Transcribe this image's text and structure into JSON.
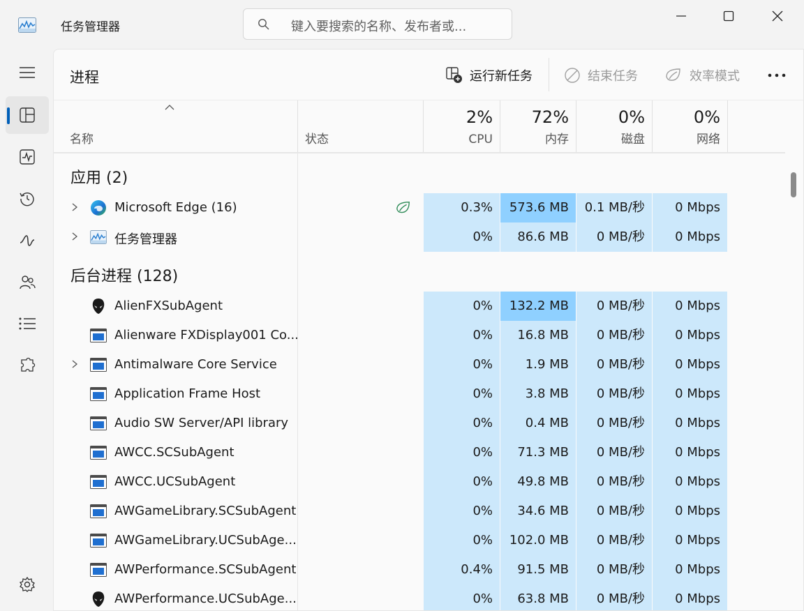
{
  "window": {
    "title": "任务管理器",
    "search_placeholder": "键入要搜索的名称、发布者或...",
    "controls": {
      "minimize": "minimize-icon",
      "maximize": "maximize-icon",
      "close": "close-icon"
    }
  },
  "nav": {
    "items": [
      {
        "id": "menu",
        "icon": "hamburger-icon"
      },
      {
        "id": "processes",
        "icon": "processes-icon",
        "selected": true
      },
      {
        "id": "performance",
        "icon": "performance-icon"
      },
      {
        "id": "app-history",
        "icon": "history-icon"
      },
      {
        "id": "startup",
        "icon": "startup-icon"
      },
      {
        "id": "users",
        "icon": "users-icon"
      },
      {
        "id": "details",
        "icon": "details-icon"
      },
      {
        "id": "services",
        "icon": "services-icon"
      },
      {
        "id": "settings",
        "icon": "settings-icon"
      }
    ]
  },
  "page": {
    "title": "进程",
    "commands": {
      "run_new_task": "运行新任务",
      "end_task": "结束任务",
      "efficiency_mode": "效率模式"
    }
  },
  "columns": {
    "name": "名称",
    "status": "状态",
    "cpu": {
      "label": "CPU",
      "percent": "2%"
    },
    "memory": {
      "label": "内存",
      "percent": "72%"
    },
    "disk": {
      "label": "磁盘",
      "percent": "0%"
    },
    "network": {
      "label": "网络",
      "percent": "0%"
    }
  },
  "groups": {
    "apps": {
      "title": "应用 (2)",
      "rows": [
        {
          "name": "Microsoft Edge (16)",
          "icon": "edge-icon",
          "expandable": true,
          "efficiency": true,
          "cpu": "0.3%",
          "memory": "573.6 MB",
          "disk": "0.1 MB/秒",
          "network": "0 Mbps",
          "mem_hot": true
        },
        {
          "name": "任务管理器",
          "icon": "task-manager-icon",
          "expandable": true,
          "efficiency": false,
          "cpu": "0%",
          "memory": "86.6 MB",
          "disk": "0 MB/秒",
          "network": "0 Mbps",
          "mem_hot": false
        }
      ]
    },
    "background": {
      "title": "后台进程 (128)",
      "rows": [
        {
          "name": "AlienFXSubAgent",
          "icon": "alien-icon",
          "expandable": false,
          "cpu": "0%",
          "memory": "132.2 MB",
          "disk": "0 MB/秒",
          "network": "0 Mbps",
          "mem_hot": true
        },
        {
          "name": "Alienware FXDisplay001 Co...",
          "icon": "window-app-icon",
          "expandable": false,
          "cpu": "0%",
          "memory": "16.8 MB",
          "disk": "0 MB/秒",
          "network": "0 Mbps",
          "mem_hot": false
        },
        {
          "name": "Antimalware Core Service",
          "icon": "window-app-icon",
          "expandable": true,
          "cpu": "0%",
          "memory": "1.9 MB",
          "disk": "0 MB/秒",
          "network": "0 Mbps",
          "mem_hot": false
        },
        {
          "name": "Application Frame Host",
          "icon": "window-app-icon",
          "expandable": false,
          "cpu": "0%",
          "memory": "3.8 MB",
          "disk": "0 MB/秒",
          "network": "0 Mbps",
          "mem_hot": false
        },
        {
          "name": "Audio SW Server/API library",
          "icon": "window-app-icon",
          "expandable": false,
          "cpu": "0%",
          "memory": "0.4 MB",
          "disk": "0 MB/秒",
          "network": "0 Mbps",
          "mem_hot": false
        },
        {
          "name": "AWCC.SCSubAgent",
          "icon": "window-app-icon",
          "expandable": false,
          "cpu": "0%",
          "memory": "71.3 MB",
          "disk": "0 MB/秒",
          "network": "0 Mbps",
          "mem_hot": false
        },
        {
          "name": "AWCC.UCSubAgent",
          "icon": "window-app-icon",
          "expandable": false,
          "cpu": "0%",
          "memory": "49.8 MB",
          "disk": "0 MB/秒",
          "network": "0 Mbps",
          "mem_hot": false
        },
        {
          "name": "AWGameLibrary.SCSubAgent",
          "icon": "window-app-icon",
          "expandable": false,
          "cpu": "0%",
          "memory": "34.6 MB",
          "disk": "0 MB/秒",
          "network": "0 Mbps",
          "mem_hot": false
        },
        {
          "name": "AWGameLibrary.UCSubAge...",
          "icon": "window-app-icon",
          "expandable": false,
          "cpu": "0%",
          "memory": "102.0 MB",
          "disk": "0 MB/秒",
          "network": "0 Mbps",
          "mem_hot": false
        },
        {
          "name": "AWPerformance.SCSubAgent",
          "icon": "window-app-icon",
          "expandable": false,
          "cpu": "0.4%",
          "memory": "91.5 MB",
          "disk": "0 MB/秒",
          "network": "0 Mbps",
          "mem_hot": false
        },
        {
          "name": "AWPerformance.UCSubAge...",
          "icon": "alien-icon",
          "expandable": false,
          "cpu": "0%",
          "memory": "63.8 MB",
          "disk": "0 MB/秒",
          "network": "0 Mbps",
          "mem_hot": false
        }
      ]
    }
  },
  "colors": {
    "accent": "#005fb8",
    "cell_bg": "#cce8fb",
    "cell_hot_bg": "#8fd0ff",
    "efficiency_leaf": "#2e8b57"
  }
}
